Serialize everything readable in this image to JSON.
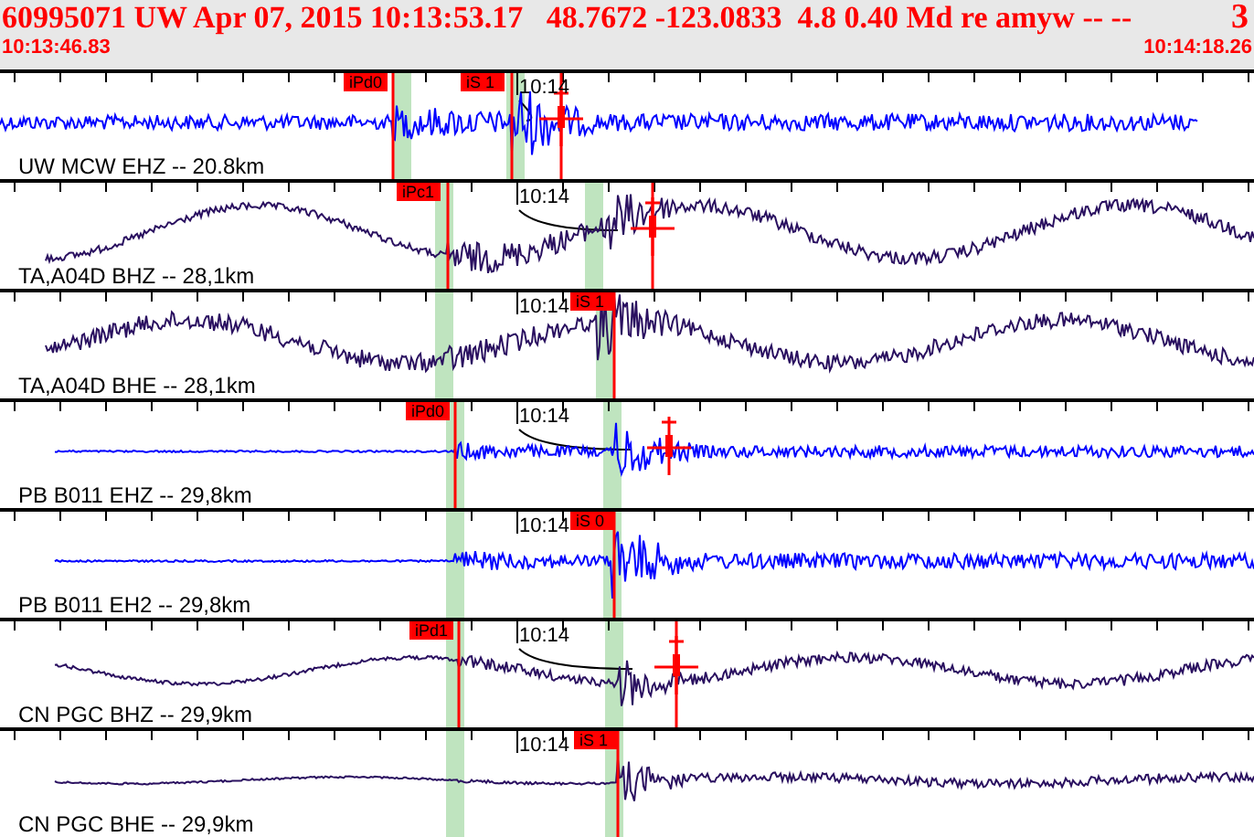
{
  "header": {
    "title": "60995071 UW Apr 07, 2015 10:13:53.17   48.7672 -123.0833  4.8 0.40 Md re amyw -- --",
    "count": "3",
    "start_time": "10:13:46.83",
    "end_time": "10:14:18.26"
  },
  "traces": [
    {
      "label": "UW MCW EHZ -- 20.8km",
      "color": "#0000ff",
      "time_label": "10:14",
      "picks": [
        "iPd0",
        "iS 1"
      ]
    },
    {
      "label": "TA,A04D BHZ -- 28,1km",
      "color": "#2a1060",
      "time_label": "10:14",
      "picks": [
        "iPc1"
      ]
    },
    {
      "label": "TA,A04D BHE -- 28,1km",
      "color": "#2a1060",
      "time_label": "10:14",
      "picks": [
        "iS 1"
      ]
    },
    {
      "label": "PB B011 EHZ -- 29,8km",
      "color": "#0000ff",
      "time_label": "10:14",
      "picks": [
        "iPd0"
      ]
    },
    {
      "label": "PB B011 EH2 -- 29,8km",
      "color": "#0000ff",
      "time_label": "10:14",
      "picks": [
        "iS 0"
      ]
    },
    {
      "label": "CN PGC BHZ -- 29,9km",
      "color": "#2a1060",
      "time_label": "10:14",
      "picks": [
        "iPd1"
      ]
    },
    {
      "label": "CN PGC BHE -- 29,9km",
      "color": "#2a1060",
      "time_label": "10:14",
      "picks": [
        "iS 1"
      ]
    }
  ]
}
